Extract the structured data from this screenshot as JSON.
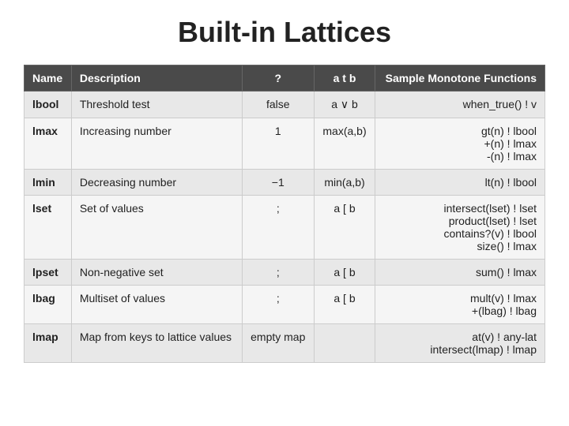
{
  "page": {
    "title": "Built-in Lattices"
  },
  "table": {
    "headers": [
      {
        "key": "name",
        "label": "Name"
      },
      {
        "key": "description",
        "label": "Description"
      },
      {
        "key": "question",
        "label": "?"
      },
      {
        "key": "atb",
        "label": "a t b"
      },
      {
        "key": "sample",
        "label": "Sample Monotone Functions"
      }
    ],
    "rows": [
      {
        "name": "lbool",
        "description": "Threshold test",
        "question": "false",
        "atb": "a ∨ b",
        "sample": "when_true() ! v"
      },
      {
        "name": "lmax",
        "description": "Increasing number",
        "question": "1",
        "atb": "max(a,b)",
        "sample": "gt(n) ! lbool\n+(n) ! lmax\n-(n) ! lmax"
      },
      {
        "name": "lmin",
        "description": "Decreasing number",
        "question": "−1",
        "atb": "min(a,b)",
        "sample": "lt(n) ! lbool"
      },
      {
        "name": "lset",
        "description": "Set of values",
        "question": ";",
        "atb": "a [ b",
        "sample": "intersect(lset) ! lset\nproduct(lset) ! lset\ncontains?(v) ! lbool\nsize() ! lmax"
      },
      {
        "name": "lpset",
        "description": "Non-negative set",
        "question": ";",
        "atb": "a [ b",
        "sample": "sum() ! lmax"
      },
      {
        "name": "lbag",
        "description": "Multiset of values",
        "question": ";",
        "atb": "a [ b",
        "sample": "mult(v) ! lmax\n+(lbag) ! lbag"
      },
      {
        "name": "lmap",
        "description": "Map from keys to lattice values",
        "question": "empty map",
        "atb": "",
        "sample": "at(v) ! any-lat\nintersect(lmap) ! lmap"
      }
    ]
  }
}
